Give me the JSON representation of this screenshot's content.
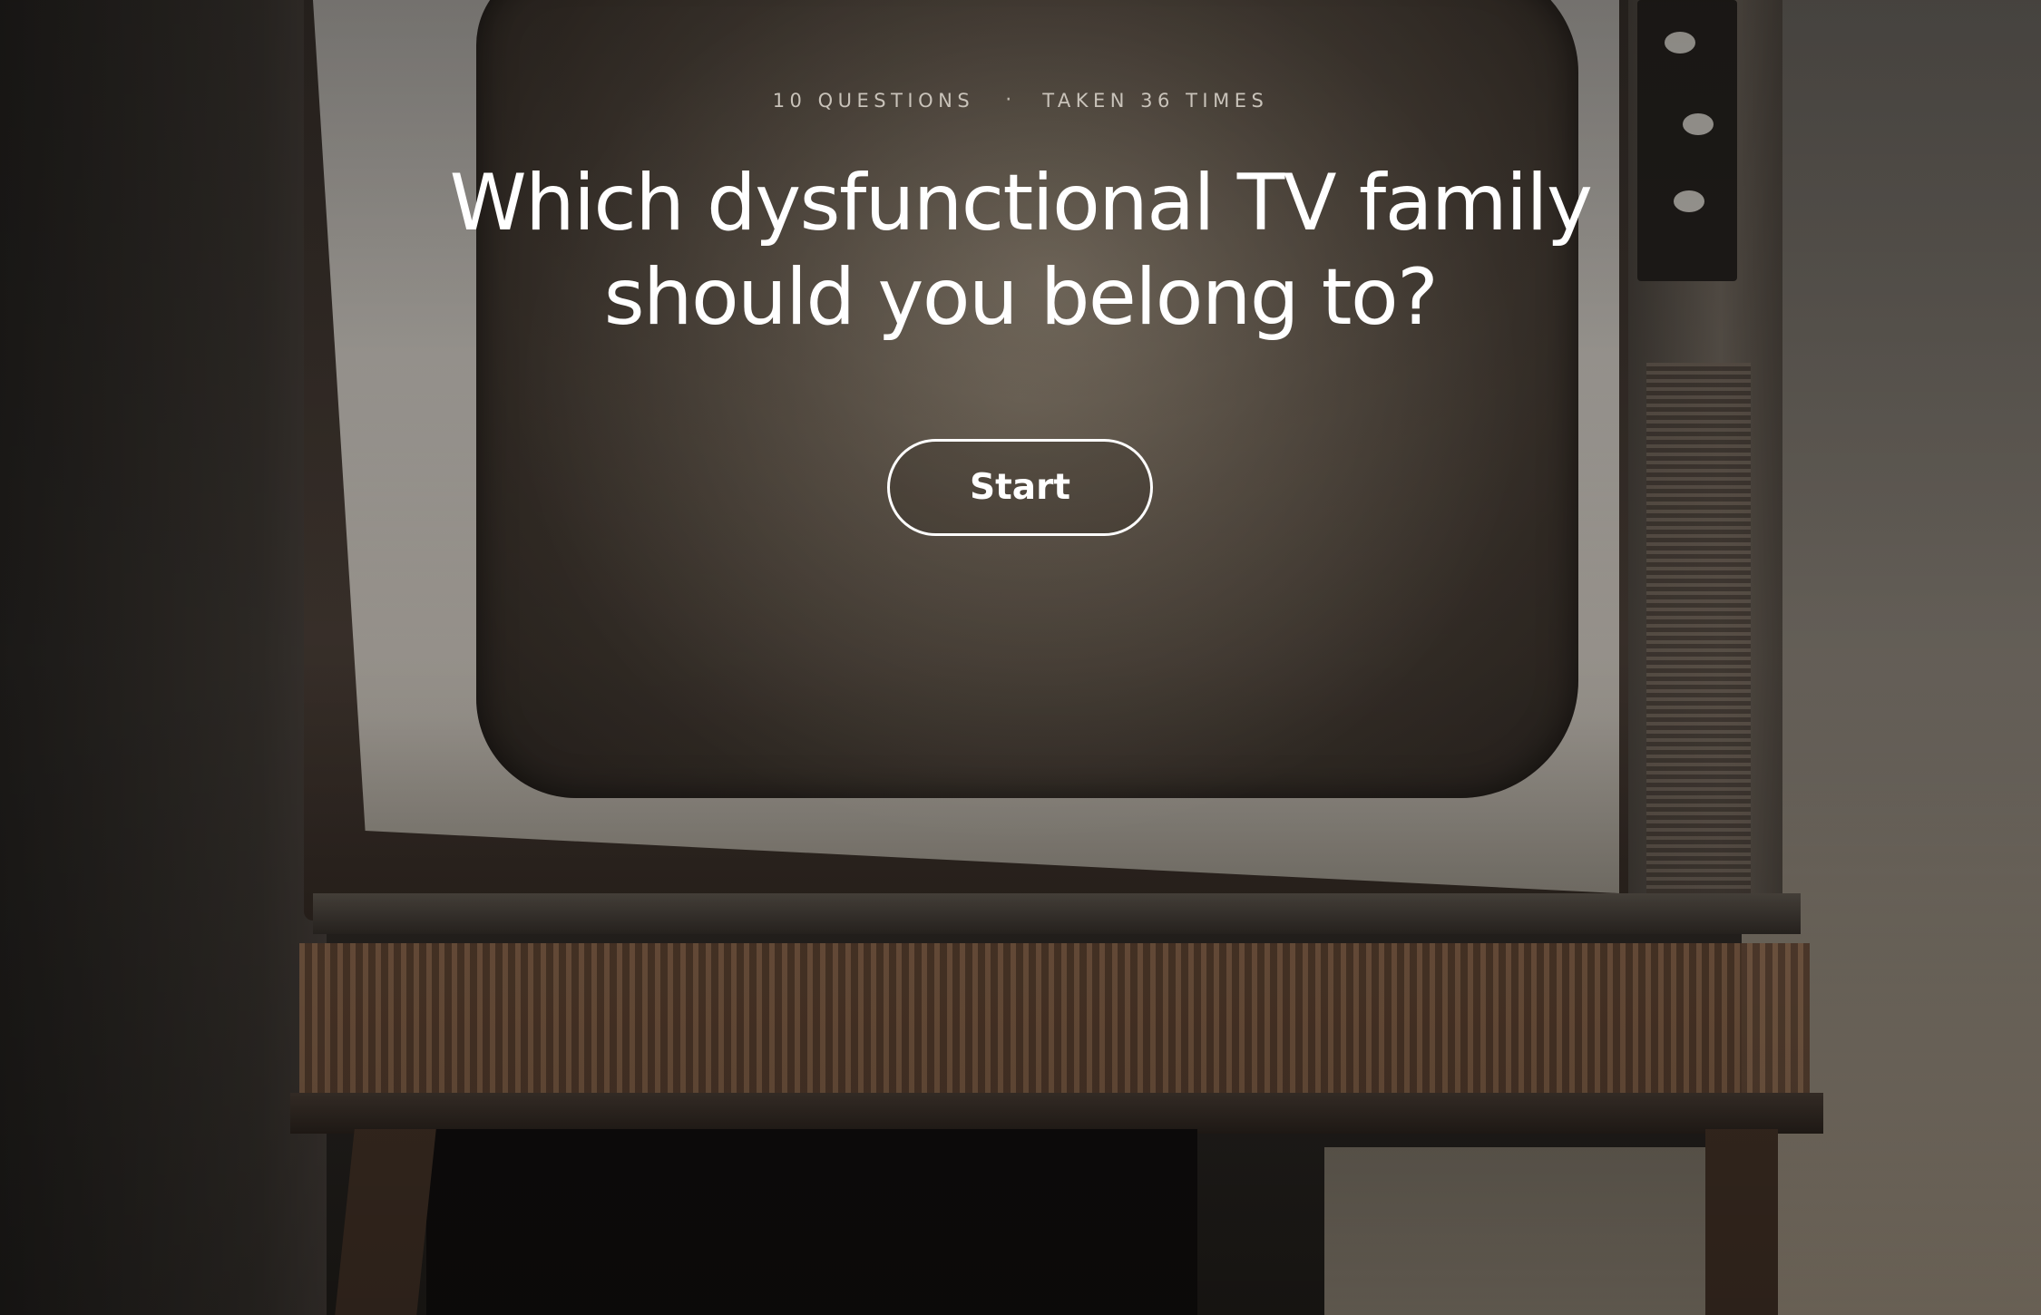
{
  "quiz": {
    "question_count": "10 QUESTIONS",
    "separator": "·",
    "taken_count": "TAKEN 36 TIMES",
    "title": "Which dysfunctional TV family should you belong to?",
    "start_label": "Start"
  },
  "background": {
    "image_subject": "retro-television-photo"
  },
  "colors": {
    "text": "#ffffff",
    "meta_text": "#c9c3ba",
    "button_border": "#ffffff"
  }
}
